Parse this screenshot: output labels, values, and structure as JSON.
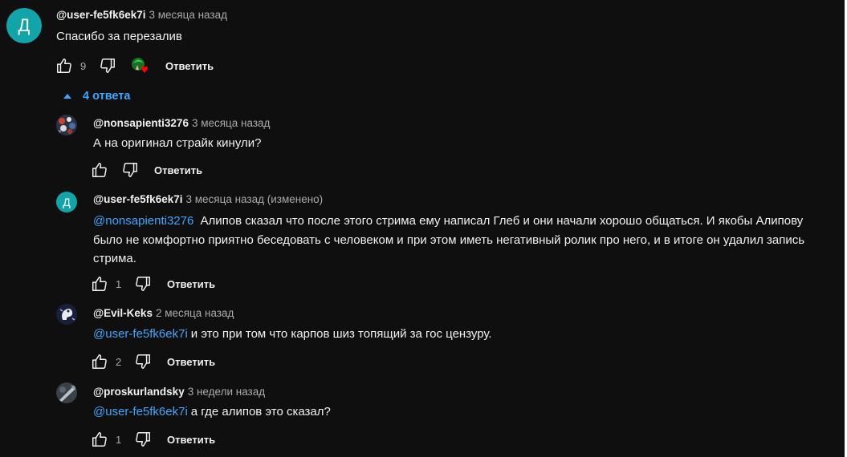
{
  "top_comment": {
    "avatar_letter": "Д",
    "author": "@user-fe5fk6ek7i",
    "time": "3 месяца назад",
    "text": "Спасибо за перезалив",
    "likes": "9",
    "reply_label": "Ответить",
    "creator_heart": true
  },
  "replies_toggle": {
    "label": "4 ответа"
  },
  "replies": [
    {
      "author": "@nonsapienti3276",
      "time": "3 месяца назад",
      "mention": "",
      "text": "А на оригинал страйк кинули?",
      "likes": "",
      "reply_label": "Ответить",
      "avatar": "image"
    },
    {
      "author": "@user-fe5fk6ek7i",
      "time": "3 месяца назад (изменено)",
      "mention": "@nonsapienti3276",
      "text": "Алипов сказал что после этого стрима ему написал Глеб и они начали хорошо общаться. И якобы Алипову было не комфортно приятно беседовать с человеком и при этом иметь негативный ролик про него, и в итоге он удалил запись стрима.",
      "likes": "1",
      "reply_label": "Ответить",
      "avatar_letter": "Д"
    },
    {
      "author": "@Evil-Keks",
      "time": "2 месяца назад",
      "mention": "@user-fe5fk6ek7i",
      "text": "и это при том что карпов шиз топящий за гос цензуру.",
      "likes": "2",
      "reply_label": "Ответить",
      "avatar": "image"
    },
    {
      "author": "@proskurlandsky",
      "time": "3 недели назад",
      "mention": "@user-fe5fk6ek7i",
      "text": "а где алипов это сказал?",
      "likes": "1",
      "reply_label": "Ответить",
      "avatar": "image"
    }
  ],
  "colors": {
    "background": "#0f0f0f",
    "link": "#3ea6ff",
    "avatar_letter_bg": "#12a4a8",
    "secondary_text": "#aaaaaa"
  },
  "icons": [
    "thumb-up-icon",
    "thumb-down-icon",
    "creator-heart-icon",
    "caret-up-icon"
  ]
}
